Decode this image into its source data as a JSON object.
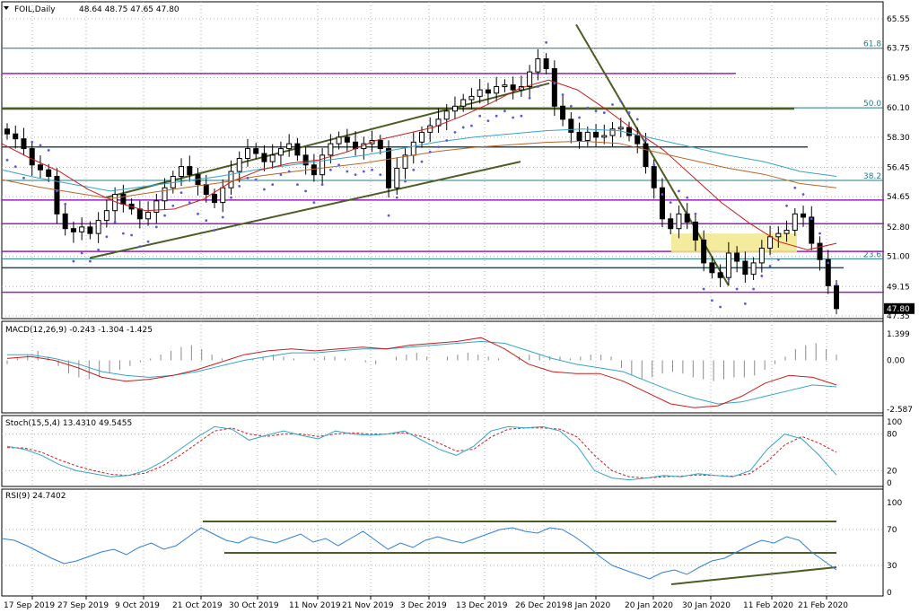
{
  "main": {
    "symbol": "FOIL,Daily",
    "ohlc": "48.64 48.75 47.65 47.80",
    "current_price": "47.80",
    "price_ticks": [
      "65.55",
      "63.75",
      "61.95",
      "60.10",
      "58.30",
      "56.45",
      "54.65",
      "52.80",
      "51.00",
      "49.15",
      "47.35"
    ],
    "fib_labels": [
      {
        "text": "61.8",
        "value": 63.75
      },
      {
        "text": "50.0",
        "value": 60.1
      },
      {
        "text": "38.2",
        "value": 55.65
      },
      {
        "text": "23.6",
        "value": 50.85
      }
    ]
  },
  "macd": {
    "label": "MACD(12,26,9) -0.243 -1.304 -1.425",
    "ticks": [
      "1.399",
      "0.00",
      "-2.587"
    ]
  },
  "stoch": {
    "label": "Stoch(15,5,4) 13.4310 49.5455",
    "ticks": [
      "100",
      "80",
      "20",
      "0"
    ]
  },
  "rsi": {
    "label": "RSI(9) 24.7402",
    "ticks": [
      "100",
      "70",
      "30",
      "0"
    ]
  },
  "date_ticks": [
    "17 Sep 2019",
    "27 Sep 2019",
    "9 Oct 2019",
    "21 Oct 2019",
    "30 Oct 2019",
    "11 Nov 2019",
    "21 Nov 2019",
    "3 Dec 2019",
    "13 Dec 2019",
    "26 Dec 2019",
    "8 Jan 2020",
    "20 Jan 2020",
    "30 Jan 2020",
    "11 Feb 2020",
    "21 Feb 2020"
  ],
  "colors": {
    "bull": "#ffffff",
    "bear": "#000000",
    "ma_red": "#c81e1e",
    "ma_blue": "#36a5c8",
    "ma_orange": "#b8672a",
    "ma_olive": "#8a9a3a",
    "trendline": "#4b5d23",
    "level_purple": "#9b1fbf",
    "level_teal": "#1f7f8a",
    "sar": "#5a5adc",
    "highlight": "#f2e88c",
    "stoch_main": "#36a5c8",
    "stoch_signal": "#c81e1e",
    "rsi_line": "#2f7fd8"
  },
  "chart_data": [
    {
      "type": "candlestick",
      "title": "FOIL,Daily",
      "ylim": [
        47.35,
        65.55
      ],
      "x": [
        "17 Sep 2019",
        "27 Sep 2019",
        "9 Oct 2019",
        "21 Oct 2019",
        "30 Oct 2019",
        "11 Nov 2019",
        "21 Nov 2019",
        "3 Dec 2019",
        "13 Dec 2019",
        "26 Dec 2019",
        "8 Jan 2020",
        "20 Jan 2020",
        "30 Jan 2020",
        "11 Feb 2020",
        "21 Feb 2020"
      ],
      "closes": [
        58.5,
        58.2,
        57.6,
        56.6,
        56.3,
        55.9,
        53.6,
        52.7,
        52.5,
        52.8,
        52.4,
        53.2,
        53.8,
        54.8,
        54.2,
        53.9,
        53.3,
        53.7,
        54.4,
        55.2,
        55.9,
        56.5,
        56.0,
        55.4,
        54.8,
        54.3,
        55.2,
        56.2,
        57.0,
        57.6,
        57.3,
        56.8,
        57.2,
        57.6,
        57.9,
        57.2,
        56.6,
        56.0,
        57.2,
        57.9,
        58.3,
        58.0,
        57.6,
        57.9,
        58.1,
        57.6,
        55.2,
        56.4,
        57.2,
        58.0,
        58.6,
        59.0,
        59.4,
        59.9,
        60.2,
        60.6,
        60.8,
        61.2,
        61.0,
        61.4,
        61.5,
        61.2,
        61.4,
        62.3,
        63.1,
        62.5,
        60.2,
        59.4,
        58.6,
        58.1,
        58.6,
        58.3,
        58.4,
        58.8,
        58.9,
        58.4,
        57.9,
        56.5,
        55.2,
        53.3,
        52.7,
        53.6,
        53.1,
        52.0,
        50.6,
        50.0,
        49.7,
        51.2,
        50.7,
        49.9,
        50.6,
        51.5,
        52.2,
        52.4,
        52.6,
        53.6,
        53.4,
        51.8,
        50.8,
        49.2,
        47.8
      ],
      "ma_red": [
        57.9,
        57.0,
        56.2,
        55.1,
        54.3,
        53.8,
        53.9,
        54.5,
        55.6,
        56.3,
        56.7,
        56.9,
        57.4,
        58.1,
        58.5,
        58.9,
        59.6,
        60.4,
        61.3,
        61.8,
        61.2,
        60.0,
        58.7,
        57.5,
        55.9,
        54.3,
        53.0,
        51.9,
        51.4,
        51.8
      ],
      "ma_blue": [
        56.3,
        55.8,
        55.4,
        55.0,
        55.3,
        55.6,
        55.9,
        56.3,
        56.6,
        56.9,
        57.2,
        57.6,
        58.0,
        58.3,
        58.5,
        58.7,
        58.8,
        58.7,
        58.2,
        57.7,
        57.2,
        56.8,
        56.2,
        55.9
      ],
      "fib_levels": {
        "61.8": 63.75,
        "50.0": 60.1,
        "38.2": 55.65,
        "23.6": 50.85
      }
    },
    {
      "type": "bar",
      "title": "MACD(12,26,9) -0.243 -1.304 -1.425",
      "ylim": [
        -2.587,
        1.399
      ],
      "histogram": [
        -0.2,
        0.1,
        0.3,
        0.5,
        0.2,
        -0.3,
        -0.7,
        -0.9,
        -1.0,
        -0.9,
        -0.7,
        -0.5,
        -0.3,
        -0.1,
        0.1,
        0.3,
        0.5,
        0.7,
        0.8,
        0.6,
        0.3,
        0.1,
        0.0,
        0.0,
        0.1,
        0.2,
        0.3,
        0.2,
        0.1,
        0.0,
        0.1,
        0.2,
        0.2,
        0.1,
        0.0,
        -0.1,
        -0.2,
        0.0,
        0.2,
        0.3,
        0.4,
        0.2,
        0.0,
        0.2,
        0.3,
        0.4,
        0.3,
        0.2,
        0.1,
        0.0,
        0.2,
        0.3,
        0.3,
        0.2,
        0.2,
        0.1,
        0.2,
        0.3,
        0.3,
        0.2,
        -0.4,
        -0.8,
        -1.0,
        -0.9,
        -0.7,
        -0.6,
        -0.7,
        -0.9,
        -1.0,
        -1.1,
        -1.0,
        -0.9,
        -0.9,
        -0.8,
        -0.5,
        -0.2,
        0.2,
        0.6,
        0.8,
        0.9,
        0.6,
        0.3
      ],
      "macd": [
        0.1,
        0.2,
        0.0,
        -0.4,
        -0.9,
        -1.1,
        -1.0,
        -0.8,
        -0.5,
        -0.1,
        0.3,
        0.5,
        0.6,
        0.5,
        0.6,
        0.7,
        0.6,
        0.8,
        0.9,
        1.0,
        1.2,
        0.6,
        -0.2,
        -0.6,
        -0.7,
        -0.7,
        -1.1,
        -1.7,
        -2.3,
        -2.5,
        -2.4,
        -1.9,
        -1.2,
        -0.8,
        -0.9,
        -1.3
      ],
      "signal": [
        0.3,
        0.3,
        0.1,
        -0.2,
        -0.6,
        -0.8,
        -0.9,
        -0.8,
        -0.6,
        -0.3,
        0.0,
        0.2,
        0.4,
        0.4,
        0.5,
        0.6,
        0.6,
        0.7,
        0.8,
        0.9,
        1.0,
        0.9,
        0.5,
        0.1,
        -0.2,
        -0.4,
        -0.6,
        -1.1,
        -1.6,
        -2.0,
        -2.3,
        -2.2,
        -1.9,
        -1.6,
        -1.3,
        -1.4
      ]
    },
    {
      "type": "line",
      "title": "Stoch(15,5,4) 13.4310 49.5455",
      "ylim": [
        0,
        100
      ],
      "series": [
        {
          "name": "main",
          "values": [
            60,
            55,
            45,
            30,
            20,
            15,
            10,
            12,
            20,
            35,
            55,
            75,
            92,
            88,
            70,
            78,
            85,
            78,
            72,
            85,
            80,
            78,
            80,
            85,
            70,
            55,
            45,
            60,
            85,
            92,
            90,
            92,
            85,
            60,
            20,
            8,
            5,
            8,
            12,
            10,
            15,
            12,
            10,
            20,
            55,
            80,
            72,
            45,
            13
          ]
        },
        {
          "name": "signal",
          "values": [
            58,
            57,
            50,
            38,
            28,
            20,
            14,
            12,
            16,
            28,
            45,
            65,
            85,
            90,
            80,
            76,
            80,
            80,
            76,
            80,
            82,
            80,
            80,
            82,
            76,
            65,
            52,
            55,
            75,
            88,
            90,
            90,
            88,
            75,
            45,
            20,
            10,
            8,
            10,
            11,
            13,
            12,
            11,
            15,
            35,
            62,
            76,
            65,
            50
          ]
        }
      ]
    },
    {
      "type": "line",
      "title": "RSI(9) 24.7402",
      "ylim": [
        0,
        100
      ],
      "series": [
        {
          "name": "RSI(9)",
          "values": [
            60,
            58,
            52,
            45,
            38,
            32,
            35,
            40,
            45,
            48,
            42,
            50,
            55,
            48,
            52,
            62,
            72,
            65,
            58,
            55,
            62,
            58,
            55,
            60,
            65,
            56,
            60,
            52,
            60,
            68,
            58,
            48,
            55,
            50,
            58,
            62,
            58,
            55,
            60,
            65,
            70,
            72,
            68,
            66,
            72,
            70,
            62,
            52,
            40,
            30,
            25,
            20,
            15,
            22,
            25,
            20,
            28,
            35,
            38,
            45,
            52,
            58,
            55,
            62,
            58,
            45,
            35,
            25
          ]
        }
      ],
      "levels": [
        70,
        30
      ]
    }
  ]
}
